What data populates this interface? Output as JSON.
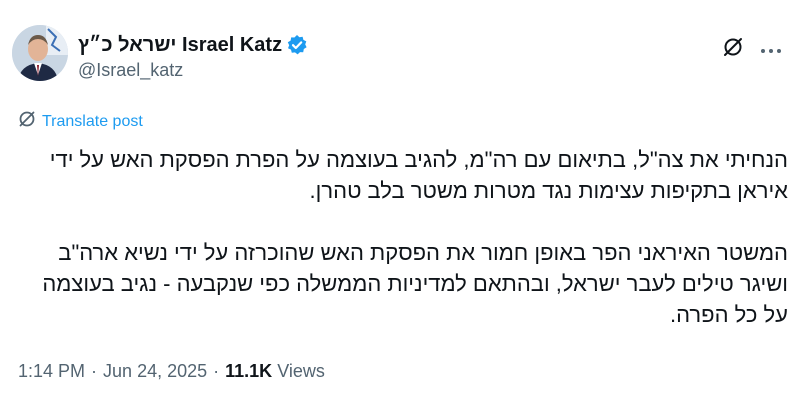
{
  "author": {
    "display_name": "ישראל כ״ץ Israel Katz",
    "handle": "@Israel_katz",
    "verified_icon": "verified-badge-icon"
  },
  "actions": {
    "grok_icon": "grok-icon",
    "more_icon": "more-options-icon"
  },
  "translate": {
    "label": "Translate post"
  },
  "tweet": {
    "paragraph_1": "הנחיתי את צה\"ל, בתיאום עם רה\"מ, להגיב בעוצמה על הפרת הפסקת האש על ידי איראן בתקיפות עצימות נגד מטרות משטר בלב טהרן.",
    "paragraph_2": "המשטר האיראני הפר באופן חמור את הפסקת האש שהוכרזה על ידי נשיא ארה\"ב ושיגר טילים לעבר ישראל, ובהתאם למדיניות הממשלה כפי שנקבעה - נגיב בעוצמה על כל הפרה."
  },
  "meta": {
    "time": "1:14 PM",
    "date": "Jun 24, 2025",
    "views_count": "11.1K",
    "views_label": "Views"
  },
  "colors": {
    "link": "#1d9bf0",
    "secondary": "#536471",
    "text": "#0f1419"
  }
}
